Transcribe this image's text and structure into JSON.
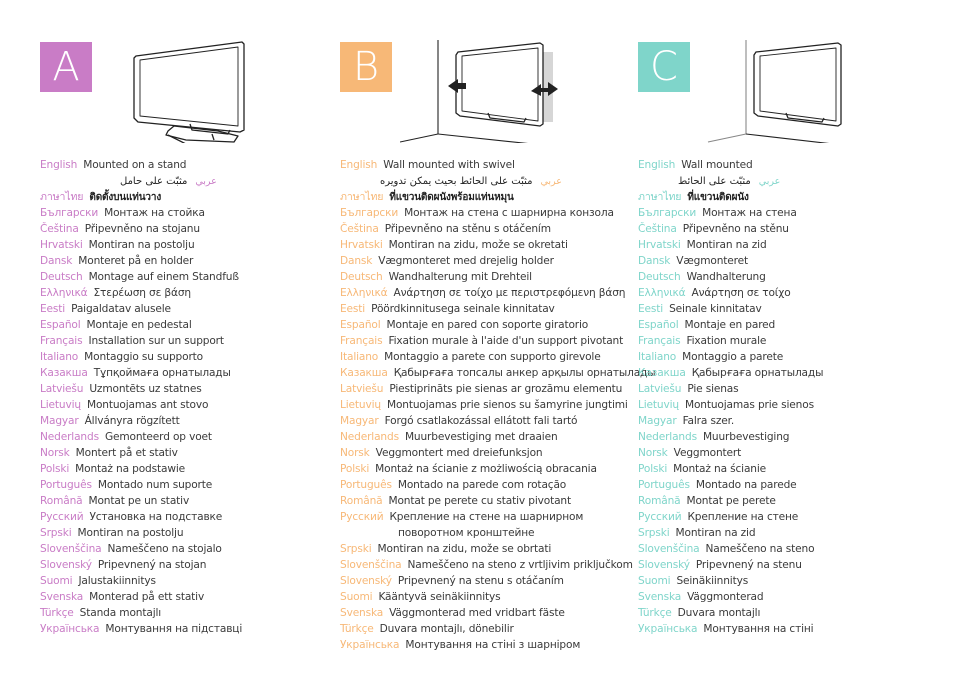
{
  "columns": [
    {
      "id": "A",
      "badge": "A",
      "color": "#c97cc6",
      "illustration": "tv-on-stand",
      "entries": [
        {
          "lang": "English",
          "text": "Mounted on a stand"
        },
        {
          "lang": "عربي",
          "text": "مثبّت على حامل",
          "rtl": true
        },
        {
          "lang": "ภาษาไทย",
          "text": "ติดตั้งบนแท่นวาง",
          "thai": true
        },
        {
          "lang": "Български",
          "text": "Монтаж на стойка"
        },
        {
          "lang": "Čeština",
          "text": "Připevněno na stojanu"
        },
        {
          "lang": "Hrvatski",
          "text": "Montiran na postolju"
        },
        {
          "lang": "Dansk",
          "text": "Monteret på en holder"
        },
        {
          "lang": "Deutsch",
          "text": "Montage auf einem Standfuß"
        },
        {
          "lang": "Ελληνικά",
          "text": "Στερέωση σε βάση"
        },
        {
          "lang": "Eesti",
          "text": "Paigaldatav alusele"
        },
        {
          "lang": "Español",
          "text": "Montaje en pedestal"
        },
        {
          "lang": "Français",
          "text": "Installation sur un support"
        },
        {
          "lang": "Italiano",
          "text": "Montaggio su supporto"
        },
        {
          "lang": "Казакша",
          "text": "Тұпқоймаға орнатылады"
        },
        {
          "lang": "Latviešu",
          "text": "Uzmontēts uz statnes"
        },
        {
          "lang": "Lietuvių",
          "text": "Montuojamas ant stovo"
        },
        {
          "lang": "Magyar",
          "text": "Állványra rögzített"
        },
        {
          "lang": "Nederlands",
          "text": "Gemonteerd op voet"
        },
        {
          "lang": "Norsk",
          "text": "Montert på et stativ"
        },
        {
          "lang": "Polski",
          "text": "Montaż na podstawie"
        },
        {
          "lang": "Português",
          "text": "Montado num suporte"
        },
        {
          "lang": "Română",
          "text": "Montat pe un stativ"
        },
        {
          "lang": "Русский",
          "text": "Установка на подставке"
        },
        {
          "lang": "Srpski",
          "text": "Montiran na postolju"
        },
        {
          "lang": "Slovenščina",
          "text": "Nameščeno na stojalo"
        },
        {
          "lang": "Slovenský",
          "text": "Pripevnený na stojan"
        },
        {
          "lang": "Suomi",
          "text": "Jalustakiinnitys"
        },
        {
          "lang": "Svenska",
          "text": "Monterad på ett stativ"
        },
        {
          "lang": "Türkçe",
          "text": "Standa montajlı"
        },
        {
          "lang": "Українська",
          "text": "Монтування на підставці"
        }
      ]
    },
    {
      "id": "B",
      "badge": "B",
      "color": "#f7b877",
      "illustration": "tv-wall-swivel",
      "entries": [
        {
          "lang": "English",
          "text": "Wall mounted with swivel"
        },
        {
          "lang": "عربي",
          "text": "مثبّت على الحائط بحيث يمكن تدويره",
          "rtl": true
        },
        {
          "lang": "ภาษาไทย",
          "text": "ที่แขวนติดผนังพร้อมแท่นหมุน",
          "thai": true
        },
        {
          "lang": "Български",
          "text": "Монтаж на стена с шарнирна конзола"
        },
        {
          "lang": "Čeština",
          "text": "Připevněno na stěnu s otáčením"
        },
        {
          "lang": "Hrvatski",
          "text": "Montiran na zidu, može se okretati"
        },
        {
          "lang": "Dansk",
          "text": "Vægmonteret med drejelig holder"
        },
        {
          "lang": "Deutsch",
          "text": "Wandhalterung mit Drehteil"
        },
        {
          "lang": "Ελληνικά",
          "text": "Ανάρτηση σε τοίχο με περιστρεφόμενη βάση"
        },
        {
          "lang": "Eesti",
          "text": "Pöördkinnitusega seinale kinnitatav"
        },
        {
          "lang": "Español",
          "text": "Montaje en pared con soporte giratorio"
        },
        {
          "lang": "Français",
          "text": "Fixation murale à l'aide d'un support pivotant"
        },
        {
          "lang": "Italiano",
          "text": "Montaggio a parete con supporto girevole"
        },
        {
          "lang": "Казакша",
          "text": "Қабырғаға топсалы анкер арқылы орнатылады"
        },
        {
          "lang": "Latviešu",
          "text": "Piestiprināts pie sienas ar grozāmu elementu"
        },
        {
          "lang": "Lietuvių",
          "text": "Montuojamas prie sienos su šamyrine jungtimi"
        },
        {
          "lang": "Magyar",
          "text": "Forgó csatlakozással ellátott fali tartó"
        },
        {
          "lang": "Nederlands",
          "text": "Muurbevestiging met draaien"
        },
        {
          "lang": "Norsk",
          "text": "Veggmontert med dreiefunksjon"
        },
        {
          "lang": "Polski",
          "text": "Montaż na ścianie z możliwością obracania"
        },
        {
          "lang": "Português",
          "text": "Montado na parede com rotação"
        },
        {
          "lang": "Română",
          "text": "Montat pe perete cu stativ pivotant"
        },
        {
          "lang": "Русский",
          "text": "Крепление на стене на шарнирном",
          "cont": "поворотном кронштейне"
        },
        {
          "lang": "Srpski",
          "text": "Montiran na zidu, može se obrtati"
        },
        {
          "lang": "Slovenščina",
          "text": "Nameščeno na steno z vrtljivim priključkom"
        },
        {
          "lang": "Slovenský",
          "text": "Pripevnený na stenu s otáčaním"
        },
        {
          "lang": "Suomi",
          "text": "Kääntyvä seinäkiinnitys"
        },
        {
          "lang": "Svenska",
          "text": "Väggmonterad med vridbart fäste"
        },
        {
          "lang": "Türkçe",
          "text": "Duvara montajlı, dönebilir"
        },
        {
          "lang": "Українська",
          "text": "Монтування на стіні з шарніром"
        }
      ]
    },
    {
      "id": "C",
      "badge": "C",
      "color": "#7fd5ca",
      "illustration": "tv-wall-fixed",
      "entries": [
        {
          "lang": "English",
          "text": "Wall mounted"
        },
        {
          "lang": "عربي",
          "text": "مثبّت على الحائط",
          "rtl": true
        },
        {
          "lang": "ภาษาไทย",
          "text": "ที่แขวนติดผนัง",
          "thai": true
        },
        {
          "lang": "Български",
          "text": "Монтаж на стена"
        },
        {
          "lang": "Čeština",
          "text": "Připevněno na stěnu"
        },
        {
          "lang": "Hrvatski",
          "text": "Montiran na zid"
        },
        {
          "lang": "Dansk",
          "text": "Vægmonteret"
        },
        {
          "lang": "Deutsch",
          "text": "Wandhalterung"
        },
        {
          "lang": "Ελληνικά",
          "text": "Ανάρτηση σε τοίχο"
        },
        {
          "lang": "Eesti",
          "text": "Seinale kinnitatav"
        },
        {
          "lang": "Español",
          "text": "Montaje en pared"
        },
        {
          "lang": "Français",
          "text": "Fixation murale"
        },
        {
          "lang": "Italiano",
          "text": "Montaggio a parete"
        },
        {
          "lang": "Казакша",
          "text": "Қабырғаға орнатылады"
        },
        {
          "lang": "Latviešu",
          "text": "Pie sienas"
        },
        {
          "lang": "Lietuvių",
          "text": "Montuojamas prie sienos"
        },
        {
          "lang": "Magyar",
          "text": "Falra szer."
        },
        {
          "lang": "Nederlands",
          "text": "Muurbevestiging"
        },
        {
          "lang": "Norsk",
          "text": "Veggmontert"
        },
        {
          "lang": "Polski",
          "text": "Montaż na ścianie"
        },
        {
          "lang": "Português",
          "text": "Montado na parede"
        },
        {
          "lang": "Română",
          "text": "Montat pe perete"
        },
        {
          "lang": "Русский",
          "text": "Крепление на стене"
        },
        {
          "lang": "Srpski",
          "text": "Montiran na zid"
        },
        {
          "lang": "Slovenščina",
          "text": "Nameščeno na steno"
        },
        {
          "lang": "Slovenský",
          "text": "Pripevnený na stenu"
        },
        {
          "lang": "Suomi",
          "text": "Seinäkiinnitys"
        },
        {
          "lang": "Svenska",
          "text": "Väggmonterad"
        },
        {
          "lang": "Türkçe",
          "text": "Duvara montajlı"
        },
        {
          "lang": "Українська",
          "text": "Монтування на стіні"
        }
      ]
    }
  ]
}
